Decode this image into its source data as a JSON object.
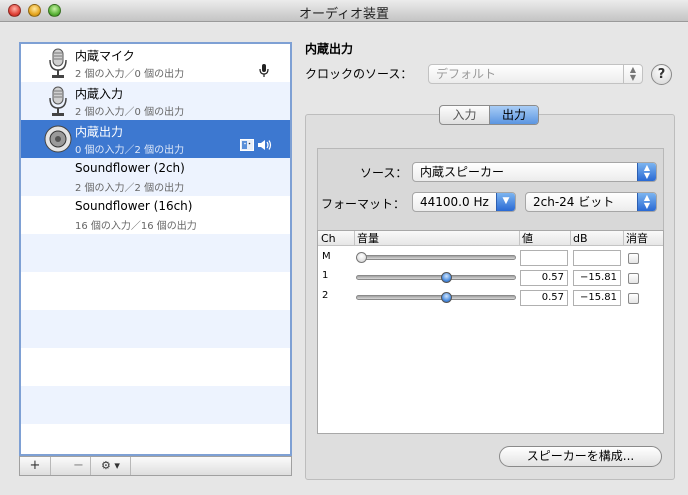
{
  "window": {
    "title": "オーディオ装置"
  },
  "devices": [
    {
      "name": "内蔵マイク",
      "io": "2 個の入力／0 個の出力",
      "icon": "microphone-icon"
    },
    {
      "name": "内蔵入力",
      "io": "2 個の入力／0 個の出力",
      "icon": "microphone-icon"
    },
    {
      "name": "内蔵出力",
      "io": "0 個の入力／2 個の出力",
      "icon": "speaker-icon",
      "selected": true
    },
    {
      "name": "Soundflower (2ch)",
      "io": "2 個の入力／2 個の出力"
    },
    {
      "name": "Soundflower (16ch)",
      "io": "16 個の入力／16 個の出力"
    }
  ],
  "list_toolbar": {
    "add": "+",
    "remove": "−",
    "action": "⚙ ▾"
  },
  "detail": {
    "title": "内蔵出力",
    "clock_label": "クロックのソース：",
    "clock_value": "デフォルト",
    "help": "?",
    "tabs": [
      {
        "label": "入力"
      },
      {
        "label": "出力",
        "active": true
      }
    ],
    "source_label": "ソース：",
    "source_value": "内蔵スピーカー",
    "format_label": "フォーマット：",
    "format_rate": "44100.0 Hz",
    "format_bits": "2ch-24 ビット",
    "table": {
      "headers": {
        "ch": "Ch",
        "volume": "音量",
        "value": "値",
        "db": "dB",
        "mute": "消音"
      },
      "rows": [
        {
          "ch": "M",
          "value": "",
          "db": "",
          "level": 0.0
        },
        {
          "ch": "1",
          "value": "0.57",
          "db": "−15.81",
          "level": 0.57
        },
        {
          "ch": "2",
          "value": "0.57",
          "db": "−15.81",
          "level": 0.57
        }
      ]
    },
    "configure_button": "スピーカーを構成..."
  },
  "colors": {
    "selection": "#3d78d0",
    "alt_row": "#edf3fe",
    "list_border": "#7ea0d4"
  }
}
